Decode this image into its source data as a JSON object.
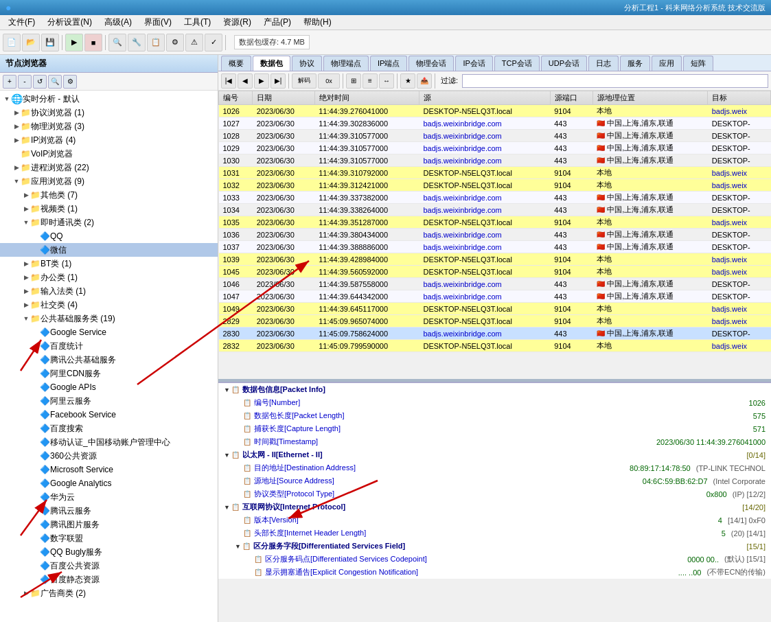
{
  "titleBar": {
    "appIcon": "●",
    "title": "分析工程1 - 科来网络分析系统 技术交流版"
  },
  "menuBar": {
    "items": [
      "文件(F)",
      "分析设置(N)",
      "高级(A)",
      "界面(V)",
      "工具(T)",
      "资源(R)",
      "产品(P)",
      "帮助(H)"
    ]
  },
  "toolbar": {
    "storageLabel": "数据包缓存: 4.7 MB"
  },
  "leftPanel": {
    "header": "节点浏览器",
    "tree": [
      {
        "id": "realtime",
        "label": "实时分析 - 默认",
        "indent": 0,
        "expand": "▼",
        "type": "root"
      },
      {
        "id": "protocol",
        "label": "协议浏览器 (1)",
        "indent": 1,
        "expand": "▶",
        "type": "item"
      },
      {
        "id": "physical",
        "label": "物理浏览器 (3)",
        "indent": 1,
        "expand": "▶",
        "type": "item"
      },
      {
        "id": "ip",
        "label": "IP浏览器 (4)",
        "indent": 1,
        "expand": "▶",
        "type": "item"
      },
      {
        "id": "voip",
        "label": "VoIP浏览器",
        "indent": 1,
        "expand": "",
        "type": "item"
      },
      {
        "id": "process",
        "label": "进程浏览器 (22)",
        "indent": 1,
        "expand": "▶",
        "type": "item"
      },
      {
        "id": "app",
        "label": "应用浏览器 (9)",
        "indent": 1,
        "expand": "▼",
        "type": "item"
      },
      {
        "id": "other",
        "label": "其他类 (7)",
        "indent": 2,
        "expand": "▶",
        "type": "sub"
      },
      {
        "id": "video",
        "label": "视频类 (1)",
        "indent": 2,
        "expand": "▶",
        "type": "sub"
      },
      {
        "id": "im",
        "label": "即时通讯类 (2)",
        "indent": 2,
        "expand": "▼",
        "type": "sub"
      },
      {
        "id": "qq",
        "label": "QQ",
        "indent": 3,
        "expand": "",
        "type": "leaf"
      },
      {
        "id": "wechat",
        "label": "微信",
        "indent": 3,
        "expand": "",
        "type": "leaf",
        "selected": true
      },
      {
        "id": "bt",
        "label": "BT类 (1)",
        "indent": 2,
        "expand": "▶",
        "type": "sub"
      },
      {
        "id": "office",
        "label": "办公类 (1)",
        "indent": 2,
        "expand": "▶",
        "type": "sub"
      },
      {
        "id": "input",
        "label": "输入法类 (1)",
        "indent": 2,
        "expand": "▶",
        "type": "sub"
      },
      {
        "id": "social",
        "label": "社交类 (4)",
        "indent": 2,
        "expand": "▶",
        "type": "sub"
      },
      {
        "id": "infra",
        "label": "公共基础服务类 (19)",
        "indent": 2,
        "expand": "▼",
        "type": "sub"
      },
      {
        "id": "googleservice",
        "label": "Google Service",
        "indent": 3,
        "expand": "",
        "type": "leaf"
      },
      {
        "id": "baidustat",
        "label": "百度统计",
        "indent": 3,
        "expand": "",
        "type": "leaf"
      },
      {
        "id": "tencentbase",
        "label": "腾讯公共基础服务",
        "indent": 3,
        "expand": "",
        "type": "leaf"
      },
      {
        "id": "alicdn",
        "label": "阿里CDN服务",
        "indent": 3,
        "expand": "",
        "type": "leaf"
      },
      {
        "id": "googleapi",
        "label": "Google APIs",
        "indent": 3,
        "expand": "",
        "type": "leaf"
      },
      {
        "id": "aliyun",
        "label": "阿里云服务",
        "indent": 3,
        "expand": "",
        "type": "leaf"
      },
      {
        "id": "facebook",
        "label": "Facebook Service",
        "indent": 3,
        "expand": "",
        "type": "leaf"
      },
      {
        "id": "baidusearch",
        "label": "百度搜索",
        "indent": 3,
        "expand": "",
        "type": "leaf"
      },
      {
        "id": "cmaccount",
        "label": "移动认证_中国移动账户管理中心",
        "indent": 3,
        "expand": "",
        "type": "leaf"
      },
      {
        "id": "360res",
        "label": "360公共资源",
        "indent": 3,
        "expand": "",
        "type": "leaf"
      },
      {
        "id": "microsoft",
        "label": "Microsoft Service",
        "indent": 3,
        "expand": "",
        "type": "leaf"
      },
      {
        "id": "googleanalytics",
        "label": "Google Analytics",
        "indent": 3,
        "expand": "",
        "type": "leaf"
      },
      {
        "id": "huaweicloud",
        "label": "华为云",
        "indent": 3,
        "expand": "",
        "type": "leaf"
      },
      {
        "id": "tencentcloud",
        "label": "腾讯云服务",
        "indent": 3,
        "expand": "",
        "type": "leaf"
      },
      {
        "id": "tencentpic",
        "label": "腾讯图片服务",
        "indent": 3,
        "expand": "",
        "type": "leaf"
      },
      {
        "id": "shuzicom",
        "label": "数字联盟",
        "indent": 3,
        "expand": "",
        "type": "leaf"
      },
      {
        "id": "qqbugly",
        "label": "QQ Bugly服务",
        "indent": 3,
        "expand": "",
        "type": "leaf"
      },
      {
        "id": "baiducommon",
        "label": "百度公共资源",
        "indent": 3,
        "expand": "",
        "type": "leaf"
      },
      {
        "id": "baidustatic",
        "label": "百度静态资源",
        "indent": 3,
        "expand": "",
        "type": "leaf"
      },
      {
        "id": "adtype",
        "label": "广告商类 (2)",
        "indent": 2,
        "expand": "▶",
        "type": "sub"
      }
    ]
  },
  "tabs": [
    "概要",
    "数据包",
    "协议",
    "物理端点",
    "IP端点",
    "物理会话",
    "IP会话",
    "TCP会话",
    "UDP会话",
    "日志",
    "服务",
    "应用",
    "短阵"
  ],
  "activeTab": "数据包",
  "packetTable": {
    "columns": [
      "编号",
      "日期",
      "绝对时间",
      "源",
      "源端口",
      "源地理位置",
      "目标"
    ],
    "rows": [
      {
        "num": "1026",
        "date": "2023/06/30",
        "time": "11:44:39.276041000",
        "src": "DESKTOP-N5ELQ3T.local",
        "srcport": "9104",
        "loc": "本地",
        "flag": "",
        "dst": "badjs.weix",
        "color": "yellow"
      },
      {
        "num": "1027",
        "date": "2023/06/30",
        "time": "11:44:39.302836000",
        "src": "badjs.weixinbridge.com",
        "srcport": "443",
        "loc": "中国,上海,浦东,联通",
        "flag": "cn",
        "dst": "DESKTOP-",
        "color": ""
      },
      {
        "num": "1028",
        "date": "2023/06/30",
        "time": "11:44:39.310577000",
        "src": "badjs.weixinbridge.com",
        "srcport": "443",
        "loc": "中国,上海,浦东,联通",
        "flag": "cn",
        "dst": "DESKTOP-",
        "color": ""
      },
      {
        "num": "1029",
        "date": "2023/06/30",
        "time": "11:44:39.310577000",
        "src": "badjs.weixinbridge.com",
        "srcport": "443",
        "loc": "中国,上海,浦东,联通",
        "flag": "cn",
        "dst": "DESKTOP-",
        "color": ""
      },
      {
        "num": "1030",
        "date": "2023/06/30",
        "time": "11:44:39.310577000",
        "src": "badjs.weixinbridge.com",
        "srcport": "443",
        "loc": "中国,上海,浦东,联通",
        "flag": "cn",
        "dst": "DESKTOP-",
        "color": ""
      },
      {
        "num": "1031",
        "date": "2023/06/30",
        "time": "11:44:39.310792000",
        "src": "DESKTOP-N5ELQ3T.local",
        "srcport": "9104",
        "loc": "本地",
        "flag": "",
        "dst": "badjs.weix",
        "color": "yellow"
      },
      {
        "num": "1032",
        "date": "2023/06/30",
        "time": "11:44:39.312421000",
        "src": "DESKTOP-N5ELQ3T.local",
        "srcport": "9104",
        "loc": "本地",
        "flag": "",
        "dst": "badjs.weix",
        "color": "yellow"
      },
      {
        "num": "1033",
        "date": "2023/06/30",
        "time": "11:44:39.337382000",
        "src": "badjs.weixinbridge.com",
        "srcport": "443",
        "loc": "中国,上海,浦东,联通",
        "flag": "cn",
        "dst": "DESKTOP-",
        "color": ""
      },
      {
        "num": "1034",
        "date": "2023/06/30",
        "time": "11:44:39.338264000",
        "src": "badjs.weixinbridge.com",
        "srcport": "443",
        "loc": "中国,上海,浦东,联通",
        "flag": "cn",
        "dst": "DESKTOP-",
        "color": ""
      },
      {
        "num": "1035",
        "date": "2023/06/30",
        "time": "11:44:39.351287000",
        "src": "DESKTOP-N5ELQ3T.local",
        "srcport": "9104",
        "loc": "本地",
        "flag": "",
        "dst": "badjs.weix",
        "color": "yellow"
      },
      {
        "num": "1036",
        "date": "2023/06/30",
        "time": "11:44:39.380434000",
        "src": "badjs.weixinbridge.com",
        "srcport": "443",
        "loc": "中国,上海,浦东,联通",
        "flag": "cn",
        "dst": "DESKTOP-",
        "color": ""
      },
      {
        "num": "1037",
        "date": "2023/06/30",
        "time": "11:44:39.388886000",
        "src": "badjs.weixinbridge.com",
        "srcport": "443",
        "loc": "中国,上海,浦东,联通",
        "flag": "cn",
        "dst": "DESKTOP-",
        "color": ""
      },
      {
        "num": "1039",
        "date": "2023/06/30",
        "time": "11:44:39.428984000",
        "src": "DESKTOP-N5ELQ3T.local",
        "srcport": "9104",
        "loc": "本地",
        "flag": "",
        "dst": "badjs.weix",
        "color": "yellow"
      },
      {
        "num": "1045",
        "date": "2023/06/30",
        "time": "11:44:39.560592000",
        "src": "DESKTOP-N5ELQ3T.local",
        "srcport": "9104",
        "loc": "本地",
        "flag": "",
        "dst": "badjs.weix",
        "color": "yellow"
      },
      {
        "num": "1046",
        "date": "2023/06/30",
        "time": "11:44:39.587558000",
        "src": "badjs.weixinbridge.com",
        "srcport": "443",
        "loc": "中国,上海,浦东,联通",
        "flag": "cn",
        "dst": "DESKTOP-",
        "color": ""
      },
      {
        "num": "1047",
        "date": "2023/06/30",
        "time": "11:44:39.644342000",
        "src": "badjs.weixinbridge.com",
        "srcport": "443",
        "loc": "中国,上海,浦东,联通",
        "flag": "cn",
        "dst": "DESKTOP-",
        "color": ""
      },
      {
        "num": "1049",
        "date": "2023/06/30",
        "time": "11:44:39.645117000",
        "src": "DESKTOP-N5ELQ3T.local",
        "srcport": "9104",
        "loc": "本地",
        "flag": "",
        "dst": "badjs.weix",
        "color": "yellow"
      },
      {
        "num": "2829",
        "date": "2023/06/30",
        "time": "11:45:09.965074000",
        "src": "DESKTOP-N5ELQ3T.local",
        "srcport": "9104",
        "loc": "本地",
        "flag": "",
        "dst": "badjs.weix",
        "color": "yellow"
      },
      {
        "num": "2830",
        "date": "2023/06/30",
        "time": "11:45:09.758624000",
        "src": "badjs.weixinbridge.com",
        "srcport": "443",
        "loc": "中国,上海,浦东,联通",
        "flag": "cn",
        "dst": "DESKTOP-",
        "color": "blue"
      },
      {
        "num": "2832",
        "date": "2023/06/30",
        "time": "11:45:09.799590000",
        "src": "DESKTOP-N5ELQ3T.local",
        "srcport": "9104",
        "loc": "本地",
        "flag": "",
        "dst": "badjs.weix",
        "color": "yellow"
      }
    ]
  },
  "detailPanel": {
    "sections": [
      {
        "level": 0,
        "expand": "▼",
        "label": "数据包信息[Packet Info]",
        "value": "",
        "type": "section"
      },
      {
        "level": 1,
        "expand": "",
        "label": "编号[Number]",
        "value": "1026",
        "type": "field"
      },
      {
        "level": 1,
        "expand": "",
        "label": "数据包长度[Packet Length]",
        "value": "575",
        "type": "field"
      },
      {
        "level": 1,
        "expand": "",
        "label": "捕获长度[Capture Length]",
        "value": "571",
        "type": "field"
      },
      {
        "level": 1,
        "expand": "",
        "label": "时间戳[Timestamp]",
        "value": "2023/06/30 11:44:39.276041000",
        "type": "field"
      },
      {
        "level": 0,
        "expand": "▼",
        "label": "以太网 - II[Ethernet - II]",
        "value": "[0/14]",
        "type": "section"
      },
      {
        "level": 1,
        "expand": "",
        "label": "目的地址[Destination Address]",
        "value": "80:89:17:14:78:50",
        "suffix": "(TP-LINK TECHNOL",
        "type": "field"
      },
      {
        "level": 1,
        "expand": "",
        "label": "源地址[Source Address]",
        "value": "04:6C:59:BB:62:D7",
        "suffix": "(Intel Corporate",
        "type": "field"
      },
      {
        "level": 1,
        "expand": "",
        "label": "协议类型[Protocol Type]",
        "value": "0x800",
        "suffix": "(IP) [12/2]",
        "type": "field"
      },
      {
        "level": 0,
        "expand": "▼",
        "label": "互联网协议[Internet Protocol]",
        "value": "[14/20]",
        "type": "section"
      },
      {
        "level": 1,
        "expand": "",
        "label": "版本[Version]",
        "value": "4",
        "suffix": "[14/1]  0xF0",
        "type": "field"
      },
      {
        "level": 1,
        "expand": "",
        "label": "头部长度[Internet Header Length]",
        "value": "5",
        "suffix": "(20)  [14/1]",
        "type": "field"
      },
      {
        "level": 1,
        "expand": "▼",
        "label": "区分服务字段[Differentiated Services Field]",
        "value": "[15/1]",
        "type": "section"
      },
      {
        "level": 2,
        "expand": "",
        "label": "区分服务码点[Differentiated Services Codepoint]",
        "value": "0000 00..",
        "suffix": "(默认)  [15/1]",
        "type": "field"
      },
      {
        "level": 2,
        "expand": "",
        "label": "显示拥塞通告[Explicit Congestion Notification]",
        "value": ".... ..00",
        "suffix": "(不带ECN的传输)",
        "type": "field"
      }
    ]
  },
  "icons": {
    "folder": "📁",
    "globe": "🌐",
    "app": "📊",
    "expand": "▶",
    "collapse": "▼"
  }
}
